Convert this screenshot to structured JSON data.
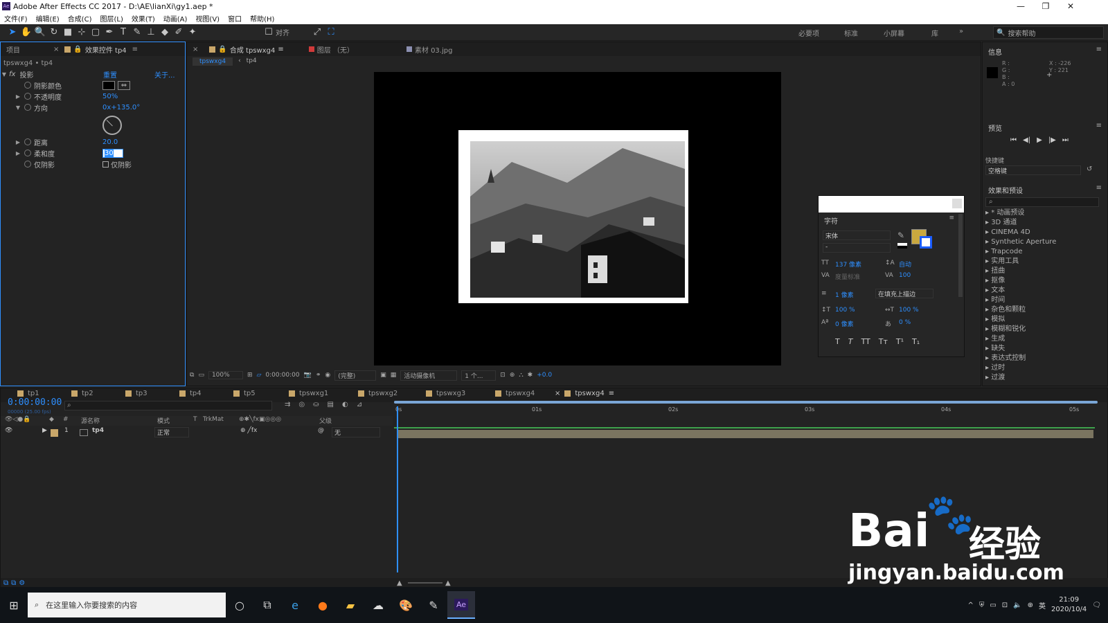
{
  "window": {
    "title": "Adobe After Effects CC 2017 - D:\\AE\\lianXi\\gy1.aep *",
    "logo": "Ae",
    "minimize": "—",
    "maximize": "❐",
    "close": "✕"
  },
  "menu": [
    "文件(F)",
    "编辑(E)",
    "合成(C)",
    "图层(L)",
    "效果(T)",
    "动画(A)",
    "视图(V)",
    "窗口",
    "帮助(H)"
  ],
  "toolbar": {
    "align_label": "对齐",
    "workspaces": [
      "必要项",
      "标准",
      "小屏幕",
      "库"
    ],
    "search_help": "搜索帮助"
  },
  "effects_panel": {
    "tab_project": "项目",
    "tab_effects": "效果控件 tp4",
    "breadcrumb": "tpswxg4 • tp4",
    "fx_name": "投影",
    "reset": "重置",
    "about": "关于...",
    "props": [
      {
        "label": "阴影颜色",
        "value": ""
      },
      {
        "label": "不透明度",
        "value": "50%"
      },
      {
        "label": "方向",
        "value": "0x+135.0°"
      },
      {
        "label": "距离",
        "value": "20.0"
      },
      {
        "label": "柔和度",
        "value": "30"
      },
      {
        "label": "仅阴影",
        "value": "仅阴影"
      }
    ]
  },
  "comp_panel": {
    "tab_comp": "合成 tpswxg4",
    "tab_layer": "图层 （无）",
    "tab_footage": "素材 03.jpg",
    "crumb1": "tpswxg4",
    "crumb2": "tp4",
    "zoom": "100%",
    "timecode": "0:00:00:00",
    "quality": "(完整)",
    "camera": "活动摄像机",
    "views": "1 个...",
    "exposure": "+0.0"
  },
  "info_panel": {
    "title": "信息",
    "r": "R :",
    "g": "G :",
    "b": "B :",
    "a": "A : 0",
    "x": "X : -226",
    "y": "Y : 221"
  },
  "preview_panel": {
    "title": "预览",
    "shortcut_label": "快捷键",
    "shortcut_value": "空格键"
  },
  "effects_presets": {
    "title": "效果和预设",
    "items": [
      "* 动画预设",
      "3D 通道",
      "CINEMA 4D",
      "Synthetic Aperture",
      "Trapcode",
      "实用工具",
      "扭曲",
      "抠像",
      "文本",
      "时间",
      "杂色和颗粒",
      "模拟",
      "模糊和锐化",
      "生成",
      "缺失",
      "表达式控制",
      "过时",
      "过渡"
    ]
  },
  "character_panel": {
    "title": "字符",
    "font": "宋体",
    "style": "-",
    "size": "137 像素",
    "leading": "自动",
    "kerning": "度量标准",
    "tracking": "100",
    "stroke_width": "1 像素",
    "stroke_mode": "在填充上描边",
    "vscale": "100 %",
    "hscale": "100 %",
    "baseline": "0 像素",
    "tsume": "0 %",
    "styles": [
      "T",
      "T",
      "TT",
      "Tт",
      "T¹",
      "T₁"
    ]
  },
  "timeline": {
    "tabs": [
      "tp1",
      "tp2",
      "tp3",
      "tp4",
      "tp5",
      "tpswxg1",
      "tpswxg2",
      "tpswxg3",
      "tpswxg4"
    ],
    "timecode": "0:00:00:00",
    "fps": "00000 (25.00 fps)",
    "cols": {
      "num": "#",
      "name": "源名称",
      "mode": "模式",
      "t": "T",
      "trkmat": "TrkMat",
      "parent": "父级"
    },
    "ruler": [
      "0s",
      "01s",
      "02s",
      "03s",
      "04s",
      "05s"
    ],
    "layer": {
      "num": "1",
      "name": "tp4",
      "mode": "正常",
      "parent": "无"
    }
  },
  "watermark": {
    "brand": "Bai",
    "paw": "🐾",
    "cn": "经验",
    "url": "jingyan.baidu.com"
  },
  "taskbar": {
    "search": "在这里输入你要搜索的内容",
    "time": "21:09",
    "date": "2020/10/4",
    "ime": "英"
  },
  "colors": {
    "accent": "#2e8fff",
    "label": "#c9a76a",
    "char_fill": "#c9a83f"
  }
}
